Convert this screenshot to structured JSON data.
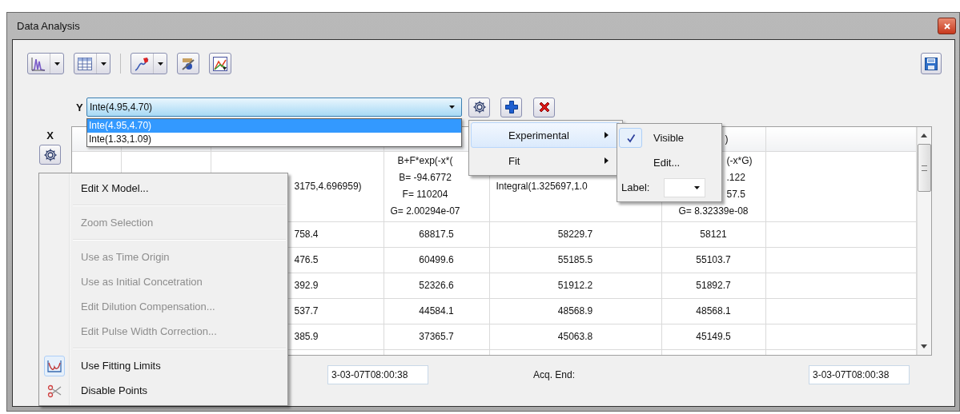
{
  "window": {
    "title": "Data Analysis"
  },
  "y_selector": {
    "label": "Y",
    "value": "Inte(4.95,4.70)",
    "options": [
      {
        "label": "Inte(4.95,4.70)",
        "selected": true
      },
      {
        "label": "Inte(1.33,1.09)",
        "selected": false
      }
    ]
  },
  "x_label": "X",
  "table": {
    "header": {
      "column_6": ")"
    },
    "rows": [
      {
        "column_3": "3175,4.696959)",
        "column_4": [
          "B+F*exp(-x*(",
          "B= -94.6772",
          "F= 110204",
          "G= 2.00294e-07"
        ],
        "column_5": "Integral(1.325697,1.0",
        "column_6": [
          "(-x*G)",
          ".122",
          "57.5",
          "G= 8.32339e-08"
        ]
      },
      {
        "column_3": "758.4",
        "column_4": "68817.5",
        "column_5": "58229.7",
        "column_6": "58121"
      },
      {
        "column_3": "476.5",
        "column_4": "60499.6",
        "column_5": "55185.5",
        "column_6": "55103.7"
      },
      {
        "column_3": "392.9",
        "column_4": "52326.6",
        "column_5": "51912.2",
        "column_6": "51892.7"
      },
      {
        "column_3": "537.7",
        "column_4": "44584.1",
        "column_5": "48568.9",
        "column_6": "48568.1"
      },
      {
        "column_3": "385.9",
        "column_4": "37365.7",
        "column_5": "45063.8",
        "column_6": "45149.5"
      }
    ]
  },
  "footer": {
    "start_value": "3-03-07T08:00:38",
    "end_label": "Acq. End:",
    "end_value": "3-03-07T08:00:38"
  },
  "context_menu": [
    {
      "kind": "item",
      "label": "Edit X Model...",
      "disabled": false,
      "checked": false
    },
    {
      "kind": "separator"
    },
    {
      "kind": "item",
      "label": "Zoom Selection",
      "disabled": true,
      "checked": false
    },
    {
      "kind": "separator"
    },
    {
      "kind": "item",
      "label": "Use as Time Origin",
      "disabled": true,
      "checked": false
    },
    {
      "kind": "item",
      "label": "Use as Initial Concetration",
      "disabled": true,
      "checked": false
    },
    {
      "kind": "item",
      "label": "Edit Dilution Compensation...",
      "disabled": true,
      "checked": false
    },
    {
      "kind": "item",
      "label": "Edit Pulse Width Correction...",
      "disabled": true,
      "checked": false
    },
    {
      "kind": "separator"
    },
    {
      "kind": "curve",
      "label": "Use Fitting Limits",
      "disabled": false,
      "checked": true
    },
    {
      "kind": "scissors",
      "label": "Disable Points",
      "disabled": false,
      "checked": false
    }
  ],
  "series_menu": [
    {
      "label": "Experimental",
      "selected": true
    },
    {
      "label": "Fit",
      "selected": false
    }
  ],
  "submenu": [
    {
      "kind": "check",
      "label": "Visible",
      "checked": true
    },
    {
      "kind": "check",
      "label": "Edit...",
      "checked": false
    },
    {
      "kind": "combo",
      "label": "Label:"
    }
  ]
}
